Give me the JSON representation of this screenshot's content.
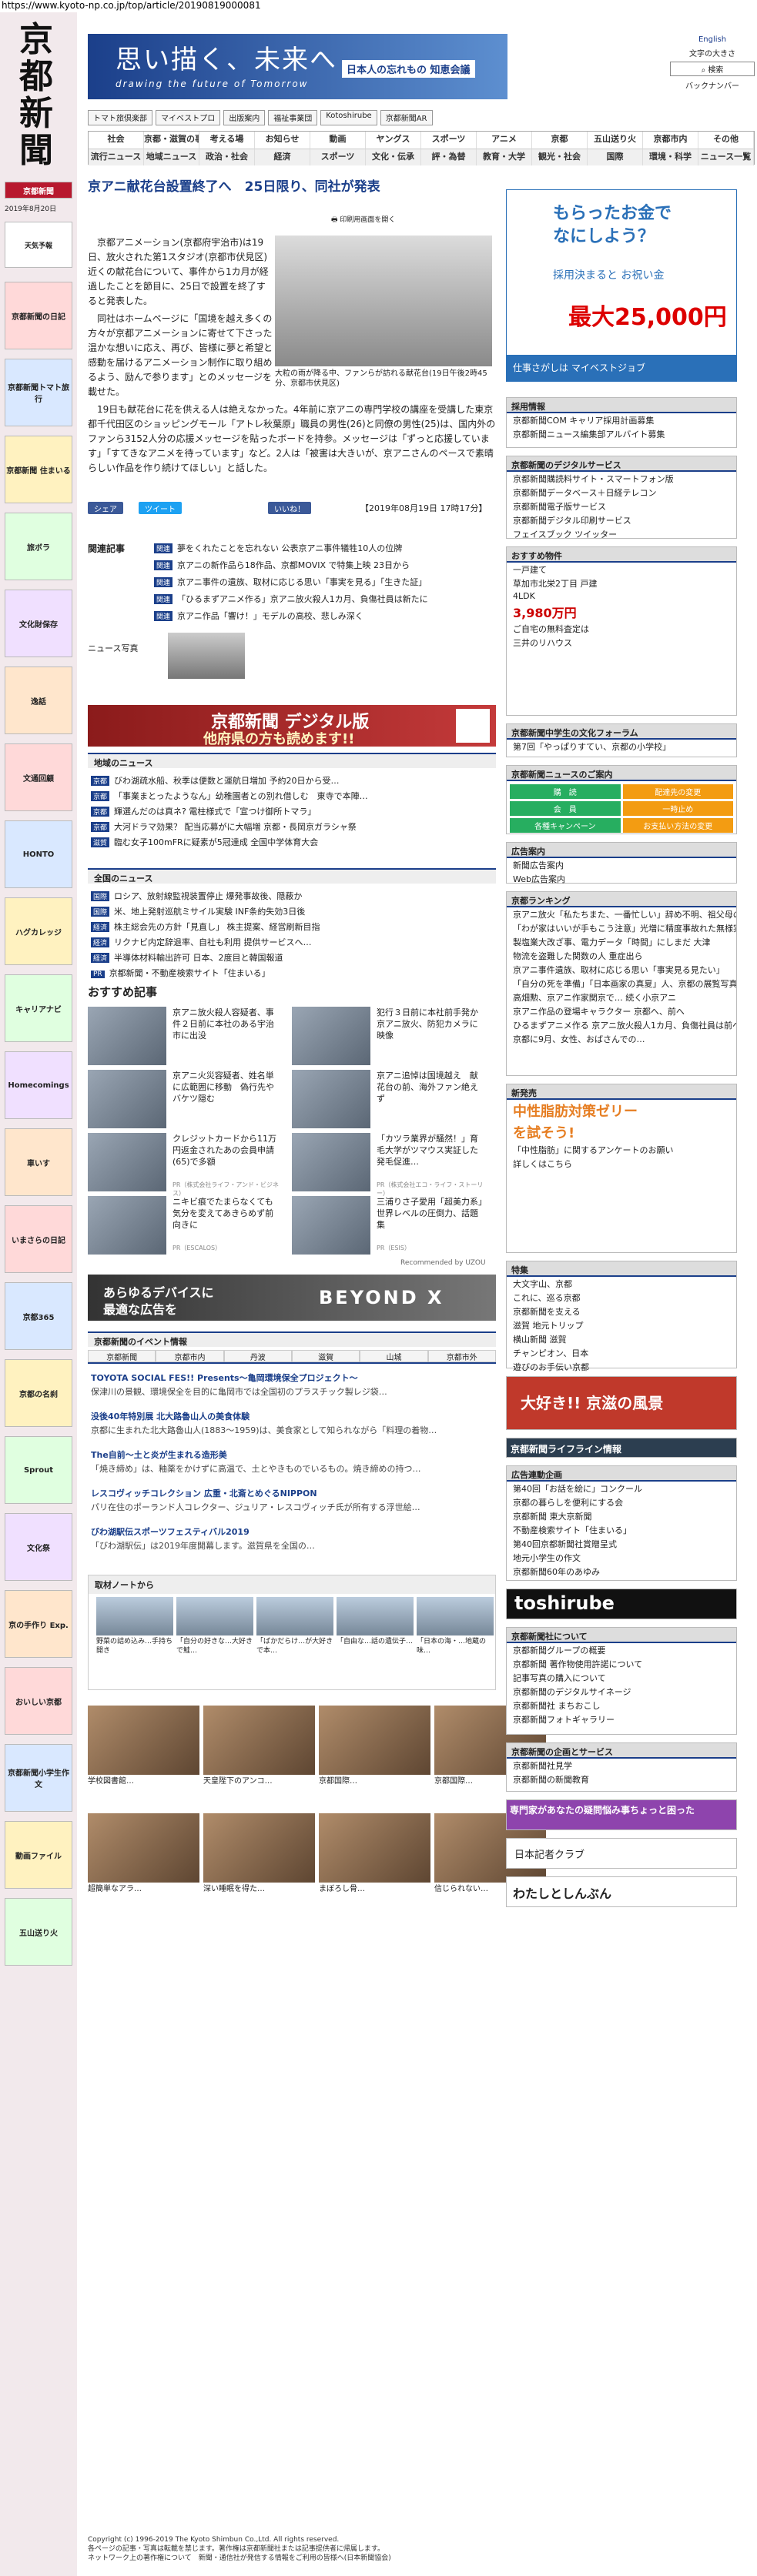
{
  "url": "https://www.kyoto-np.co.jp/top/article/20190819000081",
  "logo": "京都新聞",
  "left": {
    "date": "2019年8月20日",
    "weather_label": "天気予報",
    "links": [
      "京都新聞の日記",
      "京都新聞トマト旅行",
      "京都新聞 住まいる",
      "旅ボラ",
      "文化財保存",
      "逸話",
      "文通回顧",
      "HONTO",
      "ハグカレッジ",
      "キャリアナビ",
      "Homecomings",
      "車いす",
      "いまさらの日記",
      "京都365",
      "京都の名刹",
      "Sprout",
      "文化祭",
      "京の手作り Exp.",
      "おいしい京都",
      "京都新聞小学生作文",
      "動画ファイル",
      "五山送り火"
    ]
  },
  "banner": {
    "title": "思い描く、未来へ",
    "subtitle": "drawing the future of Tomorrow",
    "tag": "日本人の忘れもの 知恵会議"
  },
  "toplinks": {
    "english": "English",
    "fontsize": "文字の大きさ",
    "search": "検索",
    "backnumber": "バックナンバー"
  },
  "services": [
    "トマト旅倶楽部",
    "マイベストプロ",
    "出版案内",
    "福祉事業団",
    "Kotoshirube",
    "京都新聞AR"
  ],
  "nav": {
    "row1": [
      "社会",
      "京都・滋賀の事件",
      "考える場",
      "お知らせ",
      "動画",
      "ヤングス",
      "スポーツ",
      "アニメ",
      "京都",
      "五山送り火",
      "京都市内",
      "その他"
    ],
    "row2": [
      "流行ニュース",
      "地域ニュース",
      "政治・社会",
      "経済",
      "スポーツ",
      "文化・伝承",
      "評・為替",
      "教育・大学",
      "観光・社会",
      "国際",
      "環境・科学",
      "ニュース一覧"
    ]
  },
  "article": {
    "headline": "京アニ献花台設置終了へ　25日限り、同社が発表",
    "print": "印刷用画面を開く",
    "paragraphs": [
      "京都アニメーション(京都府宇治市)は19日、放火された第1スタジオ(京都市伏見区)近くの献花台について、事件から1カ月が経過したことを節目に、25日で設置を終了すると発表した。",
      "同社はホームページに「国境を越え多くの方々が京都アニメーションに寄せて下さった温かな想いに応え、再び、皆様に夢と希望と感動を届けるアニメーション制作に取り組めるよう、励んで参ります」とのメッセージを載せた。",
      "19日も献花台に花を供える人は絶えなかった。4年前に京アニの専門学校の講座を受講した東京都千代田区のショッピングモール「アトレ秋葉原」職員の男性(26)と同僚の男性(25)は、国内外のファンら3152人分の応援メッセージを貼ったボードを持参。メッセージは「ずっと応援しています」「すてきなアニメを待っています」など。2人は「被害は大きいが、京アニさんのペースで素晴らしい作品を作り続けてほしい」と話した。"
    ],
    "caption": "大粒の雨が降る中、ファンらが訪れる献花台(19日午後2時45分、京都市伏見区)",
    "tweet": "ツイート",
    "share": "シェア",
    "like": "いいね！",
    "datetime": "【2019年08月19日 17時17分】"
  },
  "related": {
    "label": "関連記事",
    "items": [
      "夢をくれたことを忘れない 公表京アニ事件犠牲10人の位牌",
      "京アニの新作品ら18作品、京都MOVIX で特集上映 23日から",
      "京アニ事件の遺族、取材に応じる思い「事実を見る」「生きた証」",
      "「ひるまずアニメ作る」京アニ放火殺人1カ月、負傷社員は新たに",
      "京アニ作品「響け！」モデルの高校、悲しみ深く"
    ],
    "badge": "関連"
  },
  "newsphoto": "ニュース写真",
  "digital": {
    "a": "京都新聞 デジタル版",
    "b": "他府県の方も読めます!!"
  },
  "local": {
    "head": "地域のニュース",
    "items": [
      "びわ湖疏水船、秋季は便数と運航日増加 予約20日から受…",
      "「事業まとったようなん」幼稚園者との別れ借しむ　東寺で本陣…",
      "輝選んだのは真ネ? 電柱様式で「宣つけ御所トマラ」",
      "大河ドラマ効果？ 配当応募がに大幅増 京都・長岡京ガラシャ祭",
      "臨む女子100mFRに疑素が5冠達成 全国中学体育大会"
    ],
    "badges": [
      "京都",
      "京都",
      "京都",
      "京都",
      "滋賀"
    ]
  },
  "national": {
    "head": "全国のニュース",
    "items": [
      "ロシア、放射線監視装置停止 爆発事故後、隠蔽か",
      "米、地上発射巡航ミサイル実験 INF条約失効3日後",
      "株主総会先の方針「見直し」 株主提案、経営刷新目指",
      "リクナビ内定辞退率、自社も利用 提供サービスへ…",
      "半導体材料輸出許可 日本、2度目と韓国報道",
      "京都新聞・不動産検索サイト「住まいる」"
    ],
    "badges": [
      "国際",
      "国際",
      "経済",
      "経済",
      "経済",
      "PR"
    ]
  },
  "recommend": {
    "head": "おすすめ記事",
    "cards": [
      {
        "t": "京アニ放火殺人容疑者、事件２日前に本社のある宇治市に出没",
        "s": ""
      },
      {
        "t": "犯行３日前に本社前手発か　京アニ放火、防犯カメラに映像",
        "s": ""
      },
      {
        "t": "京アニ火災容疑者、姓名単に広範囲に移動　偽行先やバケツ隠む",
        "s": ""
      },
      {
        "t": "京アニ追悼は国境越え　献花台の前、海外ファン絶えず",
        "s": ""
      },
      {
        "t": "クレジットカードから11万円返金されたあの会員申請(65)で多額",
        "s": "PR（株式会社ライフ・アンド・ビジネス）"
      },
      {
        "t": "「カツラ業界が騒然！」育毛大学がツマウス実証した発毛促進…",
        "s": "PR（株式会社エコ・ライフ・ストーリー）"
      },
      {
        "t": "ニキビ痕でたまらなくても気分を変えてあきらめず前向きに",
        "s": "PR（ESCALOS）"
      },
      {
        "t": "三浦りさ子愛用「超美力系」世界レベルの圧倒力、話題集",
        "s": "PR（ESIS）"
      }
    ],
    "uzou": "Recommended by UZOU"
  },
  "beyond": {
    "a": "あらゆるデバイスに",
    "b": "最適な広告を",
    "logo": "BEYOND X"
  },
  "events": {
    "head": "京都新聞のイベント情報",
    "tabs": [
      "京都新聞",
      "京都市内",
      "丹波",
      "滋賀",
      "山城",
      "京都市外"
    ],
    "items": [
      {
        "t": "TOYOTA SOCIAL FES!! Presents〜亀岡環境保全プロジェクト〜",
        "d": "保津川の景観、環境保全を目的に亀岡市では全国初のプラスチック製レジ袋…"
      },
      {
        "t": "没後40年特別展 北大路魯山人の美食体験",
        "d": "京都に生まれた北大路魯山人(1883〜1959)は、美食家として知られながら「料理の着物…"
      },
      {
        "t": "The自前〜土と炎が生まれる造形美",
        "d": "「焼き締め」は、釉薬をかけずに高温で、土とやきものでいるもの。焼き締めの持つ…"
      },
      {
        "t": "レスコヴィッチコレクション 広重・北斎とめぐるNIPPON",
        "d": "パリ在住のポーランド人コレクター、ジュリア・レスコヴィッチ氏が所有する浮世絵…"
      },
      {
        "t": "びわ湖駅伝スポーツフェスティバル2019",
        "d": "「びわ湖駅伝」は2019年度開幕します。滋賀県を全国の…"
      }
    ]
  },
  "books": {
    "head": "取材ノートから",
    "items": [
      "野菜の詰め込み…手持ち開き",
      "「自分の好きな…大好きで鮭…",
      "「ばかだらけ…が大好きで本…",
      "「自由な…話の遺伝子…",
      "「日本の海・…地蔵の味…"
    ]
  },
  "gallery": [
    {
      "t": "学校図書館…"
    },
    {
      "t": "天皇陛下のアンコ…"
    },
    {
      "t": "京都国際…"
    },
    {
      "t": "京都国際…"
    },
    {
      "t": "超簡単なアラ…"
    },
    {
      "t": "深い睡眠を得た…"
    },
    {
      "t": "まぼろし骨…"
    },
    {
      "t": "信じられない…"
    }
  ],
  "right": {
    "ad1": {
      "a": "もらったお金で",
      "b": "なにしよう？",
      "c": "採用決まると お祝い金",
      "d": "最大25,000円",
      "e": "仕事さがしは マイベストジョブ"
    },
    "recruit": {
      "head": "採用情報",
      "items": [
        "京都新聞COM キャリア採用計画募集",
        "京都新聞ニュース編集部アルバイト募集"
      ]
    },
    "digital": {
      "head": "京都新聞のデジタルサービス",
      "items": [
        "京都新聞購読料サイト・スマートフォン版",
        "京都新聞データベース＋日経テレコン",
        "京都新聞電子版サービス",
        "京都新聞デジタル印刷サービス",
        "フェイスブック ツイッター"
      ]
    },
    "property": {
      "head": "おすすめ物件",
      "a": "一戸建て",
      "b": "草加市北栄2丁目 戸建",
      "c": "4LDK",
      "d": "3,980万円",
      "e": "ご自宅の無料査定は",
      "f": "三井のリハウス"
    },
    "seikatsu": {
      "head": "京都新聞中学生の文化フォーラム",
      "items": [
        "第7回「やっぱりすてい、京都の小学校」"
      ]
    },
    "nikkan": {
      "head": "京都新聞ニュースのご案内",
      "btns": [
        "購　読",
        "配達先の変更",
        "会　員",
        "一時止め",
        "各種キャンペーン",
        "お支払い方法の変更"
      ]
    },
    "adlist": {
      "head": "広告案内",
      "items": [
        "新聞広告案内",
        "Web広告案内"
      ]
    },
    "ranking": {
      "tabs": [
        "京都ランキング",
        "全国ランキング",
        "特集"
      ],
      "items": [
        "京アニ放火「私たちまた、一番忙しい」辞め不明、祖父母の願い",
        "「わが家はいいが手もこう注意」光増に精度事故れた無様実事",
        "製塩業大改ざ事、電力データ「時間」にしまだ 大津",
        "物流を盗難した関数の人 重症出ら",
        "京アニ事件遺族、取材に応じる思い「事実見る見たい」",
        "「自分の死を準備」「日本画家の真夏」人、京都の展覧写真中",
        "高畑勲、京アニ作家関京で… 続く小京アニ",
        "京アニ作品の登場キャラクター 京都へ、前へ",
        "ひるまずアニメ作る 京アニ放火殺人1カ月、負傷社員は前へ",
        "京都に9月、女性、おばさんでの…"
      ]
    },
    "ad2": {
      "a": "新発売",
      "b": "中性脂肪対策ゼリー",
      "c": "を試そう!",
      "d": "「中性脂肪」に関するアンケートのお願い",
      "e": "詳しくはこちら"
    },
    "special": {
      "head": "特集",
      "items": [
        "大文字山、京都",
        "これに、巡る京都",
        "京都新聞を支える",
        "滋賀 地元トリップ",
        "横山新聞 滋賀",
        "チャンピオン、日本",
        "遊びのお手伝い京都"
      ]
    },
    "tokushu": "大好き!! 京滋の風景",
    "life": "京都新聞ライフライン情報",
    "komi": {
      "head": "広告連動企画",
      "items": [
        "第40回「お話を絵に」コンクール",
        "京都の暮らしを便利にする会",
        "京都新聞 東大京新聞",
        "不動産検索サイト「住まいる」",
        "第40回京都新聞社賞贈呈式",
        "地元小学生の作文",
        "京都新聞60年のあゆみ"
      ]
    },
    "toshirube": "toshirube",
    "guide": {
      "head": "京都新聞社について",
      "items": [
        "京都新聞グループの概要",
        "京都新聞 著作物使用許諾について",
        "記事写真の購入について",
        "京都新聞のデジタルサイネージ",
        "京都新聞社 まちおこし",
        "京都新聞フォトギャラリー"
      ]
    },
    "kikaku": {
      "head": "京都新聞の企画とサービス",
      "items": [
        "京都新聞社見学",
        "京都新聞の新聞教育"
      ]
    },
    "worry": "専門家があなたの疑問悩み事ちょっと困った",
    "nikkei": "日本記者クラブ",
    "watashi": "わたしとしんぶん"
  },
  "footer": {
    "copy": "Copyright (c) 1996-2019 The Kyoto Shimbun Co.,Ltd. All rights reserved.",
    "note1": "各ページの記事・写真は転載を禁じます。著作権は京都新聞社または記事提供者に帰属します。",
    "note2": "ネットワーク上の著作権について　新聞・通信社が発信する情報をご利用の皆様へ(日本新聞協会)"
  }
}
